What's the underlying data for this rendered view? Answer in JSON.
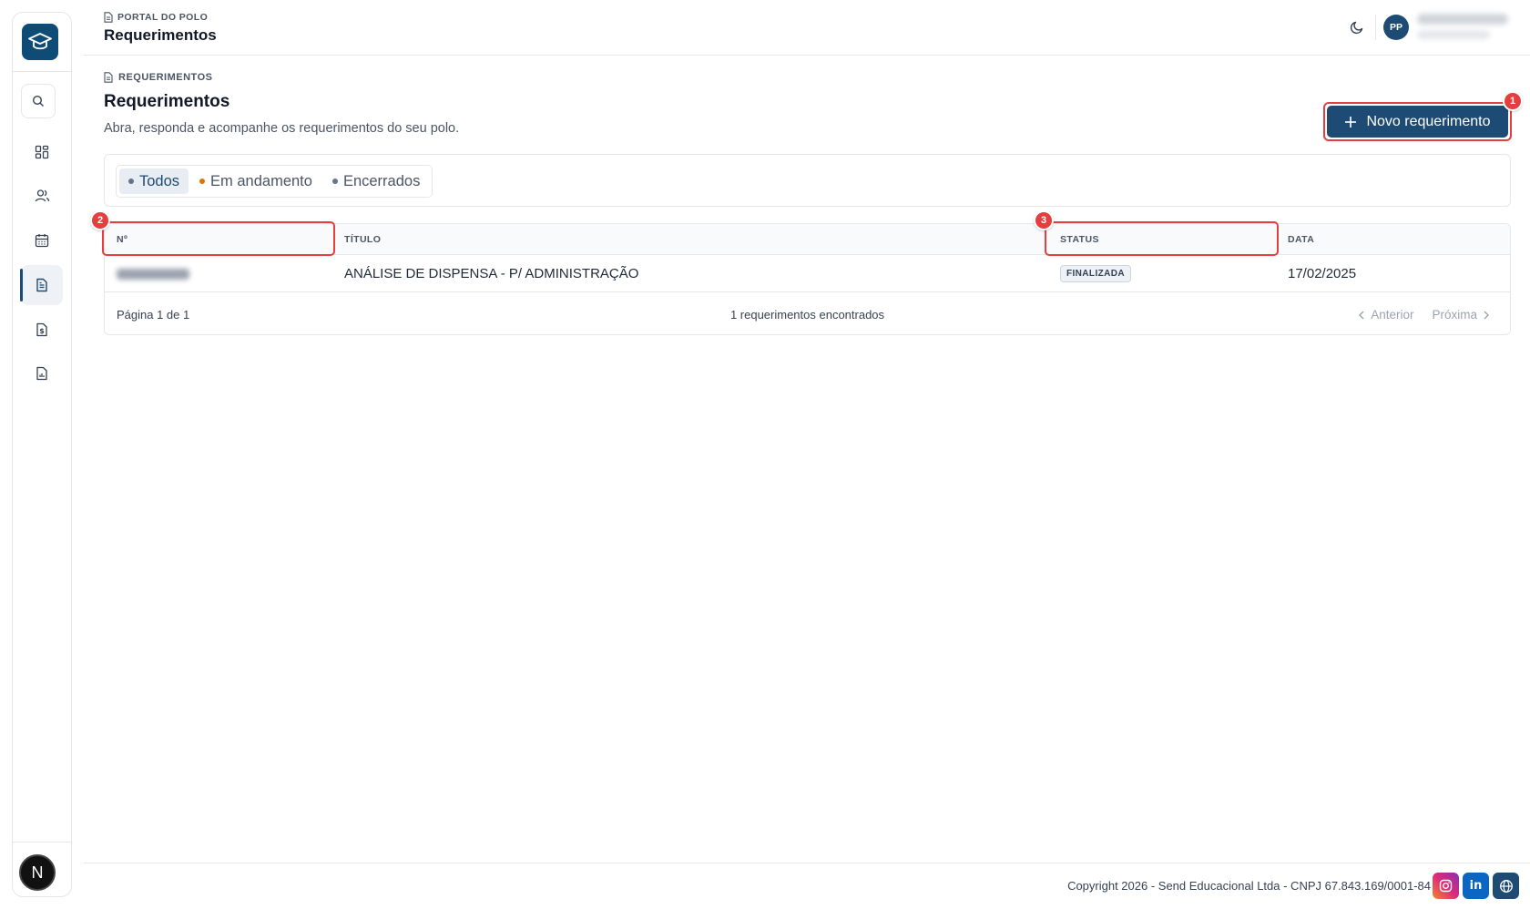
{
  "header": {
    "breadcrumb": "PORTAL DO POLO",
    "title": "Requerimentos",
    "avatar_initials": "PP"
  },
  "page": {
    "breadcrumb": "REQUERIMENTOS",
    "title": "Requerimentos",
    "subtitle": "Abra, responda e acompanhe os requerimentos do seu polo.",
    "new_button_label": "Novo requerimento"
  },
  "filters": [
    {
      "label": "Todos",
      "dot_color": "#64748b",
      "active": true
    },
    {
      "label": "Em andamento",
      "dot_color": "#d97706",
      "active": false
    },
    {
      "label": "Encerrados",
      "dot_color": "#64748b",
      "active": false
    }
  ],
  "table": {
    "columns": [
      "Nº",
      "TÍTULO",
      "STATUS",
      "DATA"
    ],
    "rows": [
      {
        "titulo": "ANÁLISE DE DISPENSA - P/ ADMINISTRAÇÃO",
        "status": "FINALIZADA",
        "data": "17/02/2025"
      }
    ],
    "page_info": "Página 1 de 1",
    "results_count": "1 requerimentos encontrados",
    "prev_label": "Anterior",
    "next_label": "Próxima"
  },
  "markers": [
    "1",
    "2",
    "3"
  ],
  "footer": {
    "copyright": "Copyright 2026 - Send Educacional Ltda - CNPJ 67.843.169/0001-84"
  },
  "sidebar": {
    "items": [
      "search-icon",
      "dashboard-icon",
      "users-icon",
      "calendar-icon",
      "document-icon",
      "finance-icon",
      "report-icon"
    ],
    "badge": "N"
  },
  "colors": {
    "primary": "#1e4b73",
    "highlight": "#e53e3e",
    "instagram": "#d62976",
    "linkedin": "#0a66c2",
    "website": "#1e4b73"
  }
}
